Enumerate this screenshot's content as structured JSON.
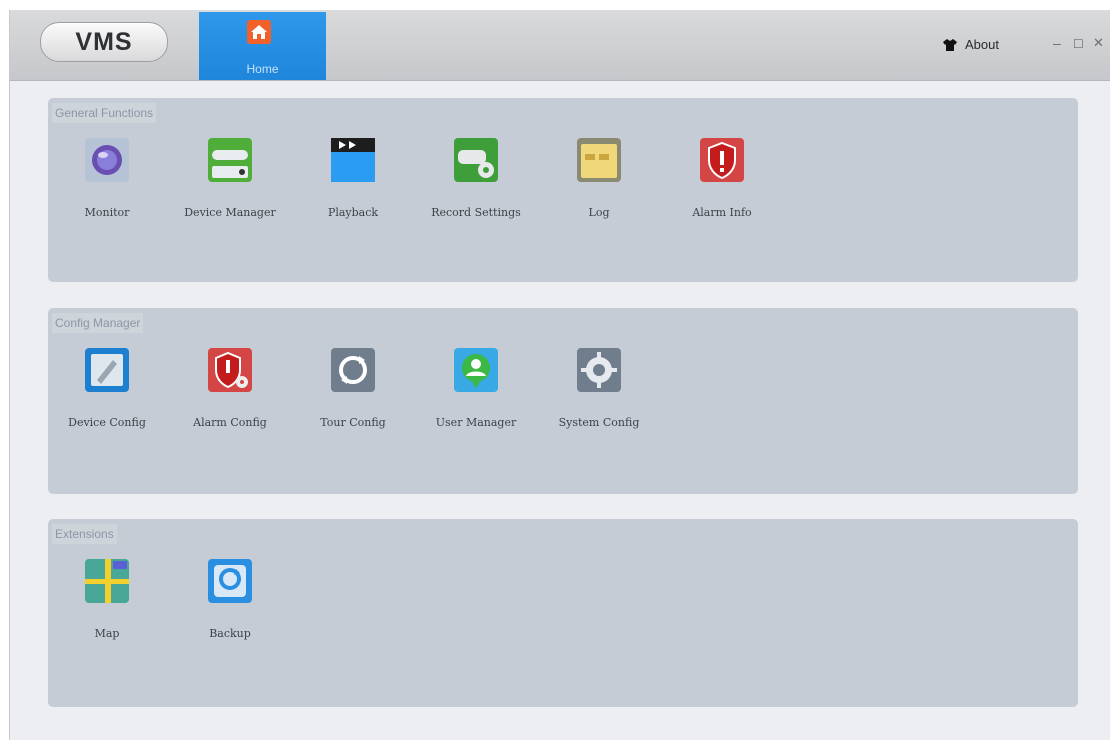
{
  "titlebar": {
    "logo": "VMS",
    "home_tab": "Home",
    "about": "About",
    "minimize": "–",
    "maximize": "☐",
    "close": "✕"
  },
  "sections": [
    {
      "title": "General Functions",
      "items": [
        {
          "label": "Monitor",
          "icon": "monitor-icon"
        },
        {
          "label": "Device Manager",
          "icon": "device-manager-icon"
        },
        {
          "label": "Playback",
          "icon": "playback-icon"
        },
        {
          "label": "Record Settings",
          "icon": "record-settings-icon"
        },
        {
          "label": "Log",
          "icon": "log-icon"
        },
        {
          "label": "Alarm Info",
          "icon": "alarm-info-icon"
        }
      ]
    },
    {
      "title": "Config Manager",
      "items": [
        {
          "label": "Device Config",
          "icon": "device-config-icon"
        },
        {
          "label": "Alarm Config",
          "icon": "alarm-config-icon"
        },
        {
          "label": "Tour Config",
          "icon": "tour-config-icon"
        },
        {
          "label": "User Manager",
          "icon": "user-manager-icon"
        },
        {
          "label": "System Config",
          "icon": "system-config-icon"
        }
      ]
    },
    {
      "title": "Extensions",
      "items": [
        {
          "label": "Map",
          "icon": "map-icon"
        },
        {
          "label": "Backup",
          "icon": "backup-icon"
        }
      ]
    }
  ]
}
